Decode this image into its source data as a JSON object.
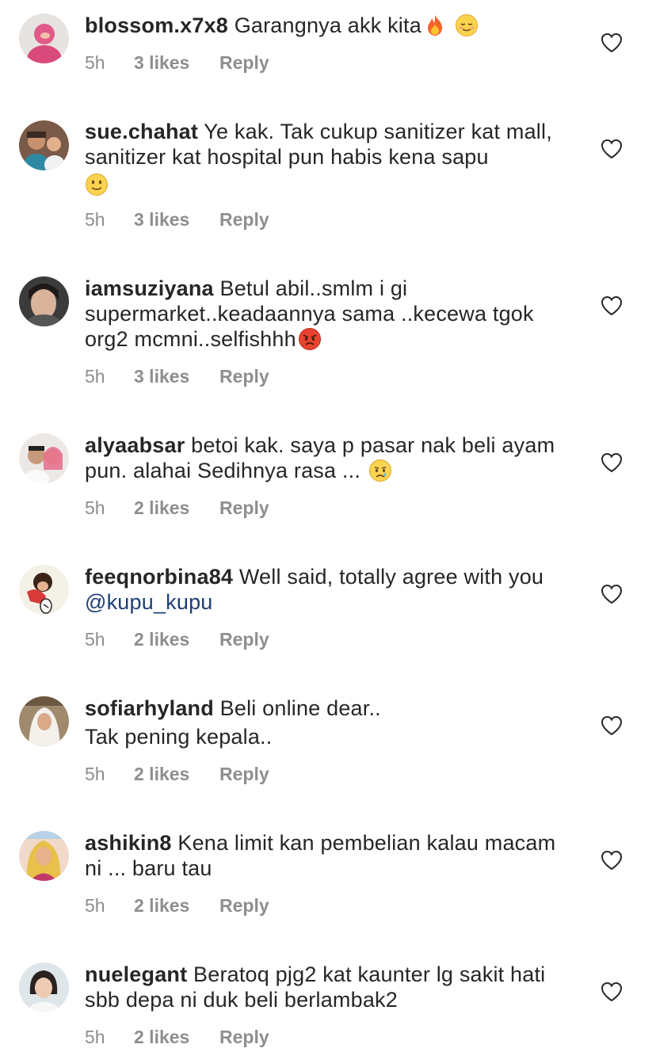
{
  "comments": [
    {
      "username": "blossom.x7x8",
      "text": "Garangnya akk kita",
      "emojis": [
        "fire-emoji",
        "relieved-face-emoji"
      ],
      "time": "5h",
      "likes": "3 likes",
      "reply": "Reply"
    },
    {
      "username": "sue.chahat",
      "text": "Ye kak. Tak cukup sanitizer kat mall, sanitizer kat hospital pun habis kena sapu",
      "emojis": [
        "slightly-smiling-face-emoji"
      ],
      "time": "5h",
      "likes": "3 likes",
      "reply": "Reply"
    },
    {
      "username": "iamsuziyana",
      "text": "Betul abil..smlm i gi supermarket..keadaannya sama ..kecewa tgok org2 mcmni..selfishhh",
      "emojis": [
        "angry-face-emoji"
      ],
      "time": "5h",
      "likes": "3 likes",
      "reply": "Reply"
    },
    {
      "username": "alyaabsar",
      "text": "betoi kak. saya p pasar nak beli ayam pun. alahai Sedihnya rasa ...",
      "emojis": [
        "crying-face-emoji"
      ],
      "time": "5h",
      "likes": "2 likes",
      "reply": "Reply"
    },
    {
      "username": "feeqnorbina84",
      "text": "Well said, totally agree with you",
      "mention": "@kupu_kupu",
      "time": "5h",
      "likes": "2 likes",
      "reply": "Reply"
    },
    {
      "username": "sofiarhyland",
      "text": "Beli online dear..",
      "text_line2": "Tak pening kepala..",
      "time": "5h",
      "likes": "2 likes",
      "reply": "Reply"
    },
    {
      "username": "ashikin8",
      "text": "Kena limit kan pembelian kalau macam ni ... baru tau",
      "time": "5h",
      "likes": "2 likes",
      "reply": "Reply"
    },
    {
      "username": "nuelegant",
      "text": "Beratoq pjg2 kat kaunter lg sakit hati sbb depa ni duk beli berlambak2",
      "time": "5h",
      "likes": "2 likes",
      "reply": "Reply"
    }
  ],
  "icons": {
    "like": "heart-outline-icon"
  },
  "colors": {
    "text": "#262626",
    "meta": "#8e8e8e",
    "mention": "#1e3f74",
    "heart_stroke": "#262626"
  }
}
